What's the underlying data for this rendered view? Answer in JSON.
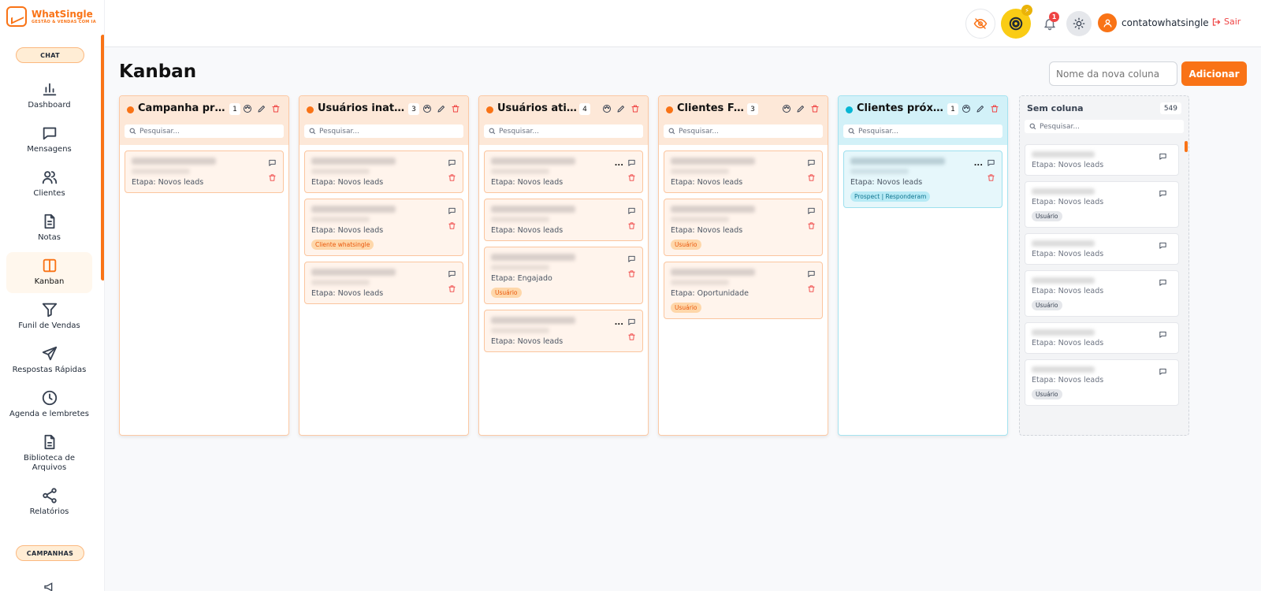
{
  "app": {
    "logo_title": "WhatSingle",
    "logo_subtitle": "GESTÃO & VENDAS COM IA"
  },
  "sidebar": {
    "section_chat": "CHAT",
    "section_campaigns": "CAMPANHAS",
    "items": [
      {
        "label": "Dashboard",
        "icon": "bar-chart-icon"
      },
      {
        "label": "Mensagens",
        "icon": "message-icon"
      },
      {
        "label": "Clientes",
        "icon": "users-icon"
      },
      {
        "label": "Notas",
        "icon": "file-text-icon"
      },
      {
        "label": "Kanban",
        "icon": "kanban-icon",
        "active": true
      },
      {
        "label": "Funil de Vendas",
        "icon": "filter-icon"
      },
      {
        "label": "Respostas Rápidas",
        "icon": "send-icon"
      },
      {
        "label": "Agenda e lembretes",
        "icon": "clock-icon"
      },
      {
        "label": "Biblioteca de Arquivos",
        "icon": "file-icon"
      },
      {
        "label": "Relatórios",
        "icon": "share-icon"
      }
    ]
  },
  "header": {
    "coin_badge": "⚡",
    "notifications_count": "1",
    "username": "contatowhatsingle",
    "logout_label": "Sair"
  },
  "main": {
    "title": "Kanban",
    "new_column_placeholder": "Nome da nova coluna",
    "add_button": "Adicionar",
    "search_placeholder": "Pesquisar..."
  },
  "columns": [
    {
      "title": "Campanha prot...",
      "count": "1",
      "color": "#f97316",
      "cards": [
        {
          "stage": "Etapa: Novos leads",
          "tag": ""
        }
      ]
    },
    {
      "title": "Usuários inativos",
      "count": "3",
      "color": "#f97316",
      "cards": [
        {
          "stage": "Etapa: Novos leads",
          "tag": ""
        },
        {
          "stage": "Etapa: Novos leads",
          "tag": "Cliente whatsingle"
        },
        {
          "stage": "Etapa: Novos leads",
          "tag": ""
        }
      ]
    },
    {
      "title": "Usuários ativos",
      "count": "4",
      "color": "#f97316",
      "cards": [
        {
          "stage": "Etapa: Novos leads",
          "tag": ""
        },
        {
          "stage": "Etapa: Novos leads",
          "tag": ""
        },
        {
          "stage": "Etapa: Engajado",
          "tag": "Usuário"
        },
        {
          "stage": "Etapa: Novos leads",
          "tag": ""
        }
      ]
    },
    {
      "title": "Clientes Frios",
      "count": "3",
      "color": "#f97316",
      "cards": [
        {
          "stage": "Etapa: Novos leads",
          "tag": ""
        },
        {
          "stage": "Etapa: Novos leads",
          "tag": "Usuário"
        },
        {
          "stage": "Etapa: Oportunidade",
          "tag": "Usuário"
        }
      ]
    },
    {
      "title": "Clientes próxim...",
      "count": "1",
      "color": "#06b6d4",
      "cards": [
        {
          "stage": "Etapa: Novos leads",
          "tag": "Prospect | Responderam"
        }
      ]
    }
  ],
  "no_column": {
    "title": "Sem coluna",
    "count": "549",
    "cards": [
      {
        "stage": "Etapa: Novos leads",
        "tag": ""
      },
      {
        "stage": "Etapa: Novos leads",
        "tag": "Usuário"
      },
      {
        "stage": "Etapa: Novos leads",
        "tag": ""
      },
      {
        "stage": "Etapa: Novos leads",
        "tag": "Usuário"
      },
      {
        "stage": "Etapa: Novos leads",
        "tag": ""
      },
      {
        "stage": "Etapa: Novos leads",
        "tag": "Usuário"
      }
    ]
  }
}
